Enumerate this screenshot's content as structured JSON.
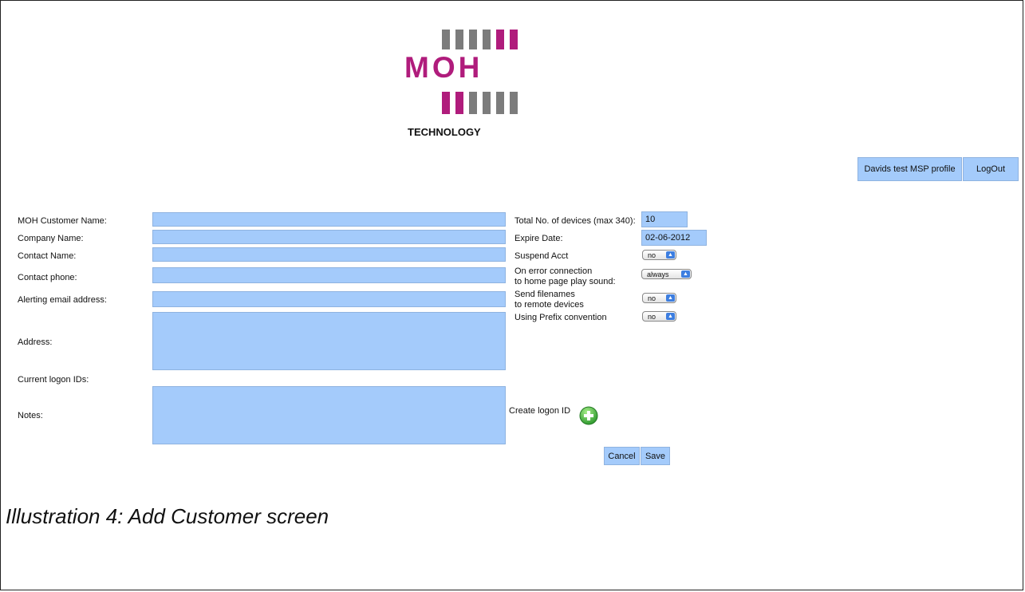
{
  "logo": {
    "brand": "MOH",
    "subtitle": "TECHNOLOGY",
    "bar_colors": [
      "#b01c7c",
      "#7c7c7c"
    ]
  },
  "header": {
    "profile_label": "Davids test MSP profile",
    "logout_label": "LogOut"
  },
  "form": {
    "customer_name_label": "MOH Customer Name:",
    "company_name_label": "Company Name:",
    "contact_name_label": "Contact Name:",
    "contact_phone_label": "Contact phone:",
    "alert_email_label": "Alerting email address:",
    "address_label": "Address:",
    "logon_ids_label": "Current logon IDs:",
    "notes_label": "Notes:",
    "devices_label": "Total No. of devices (max 340):",
    "devices_value": "10",
    "expire_label": "Expire Date:",
    "expire_value": "02-06-2012",
    "suspend_label": "Suspend Acct",
    "suspend_value": "no",
    "error_label_line1": "On error connection",
    "error_label_line2": "to home page play sound:",
    "error_value": "always",
    "send_label_line1": "Send filenames",
    "send_label_line2": "to remote devices",
    "send_value": "no",
    "prefix_label": "Using Prefix convention",
    "prefix_value": "no",
    "create_logon_label": "Create logon ID",
    "cancel_label": "Cancel",
    "save_label": "Save"
  },
  "caption": "Illustration 4: Add Customer screen",
  "colors": {
    "field_bg": "#a4cbfb",
    "add_icon": "#3db33d"
  }
}
